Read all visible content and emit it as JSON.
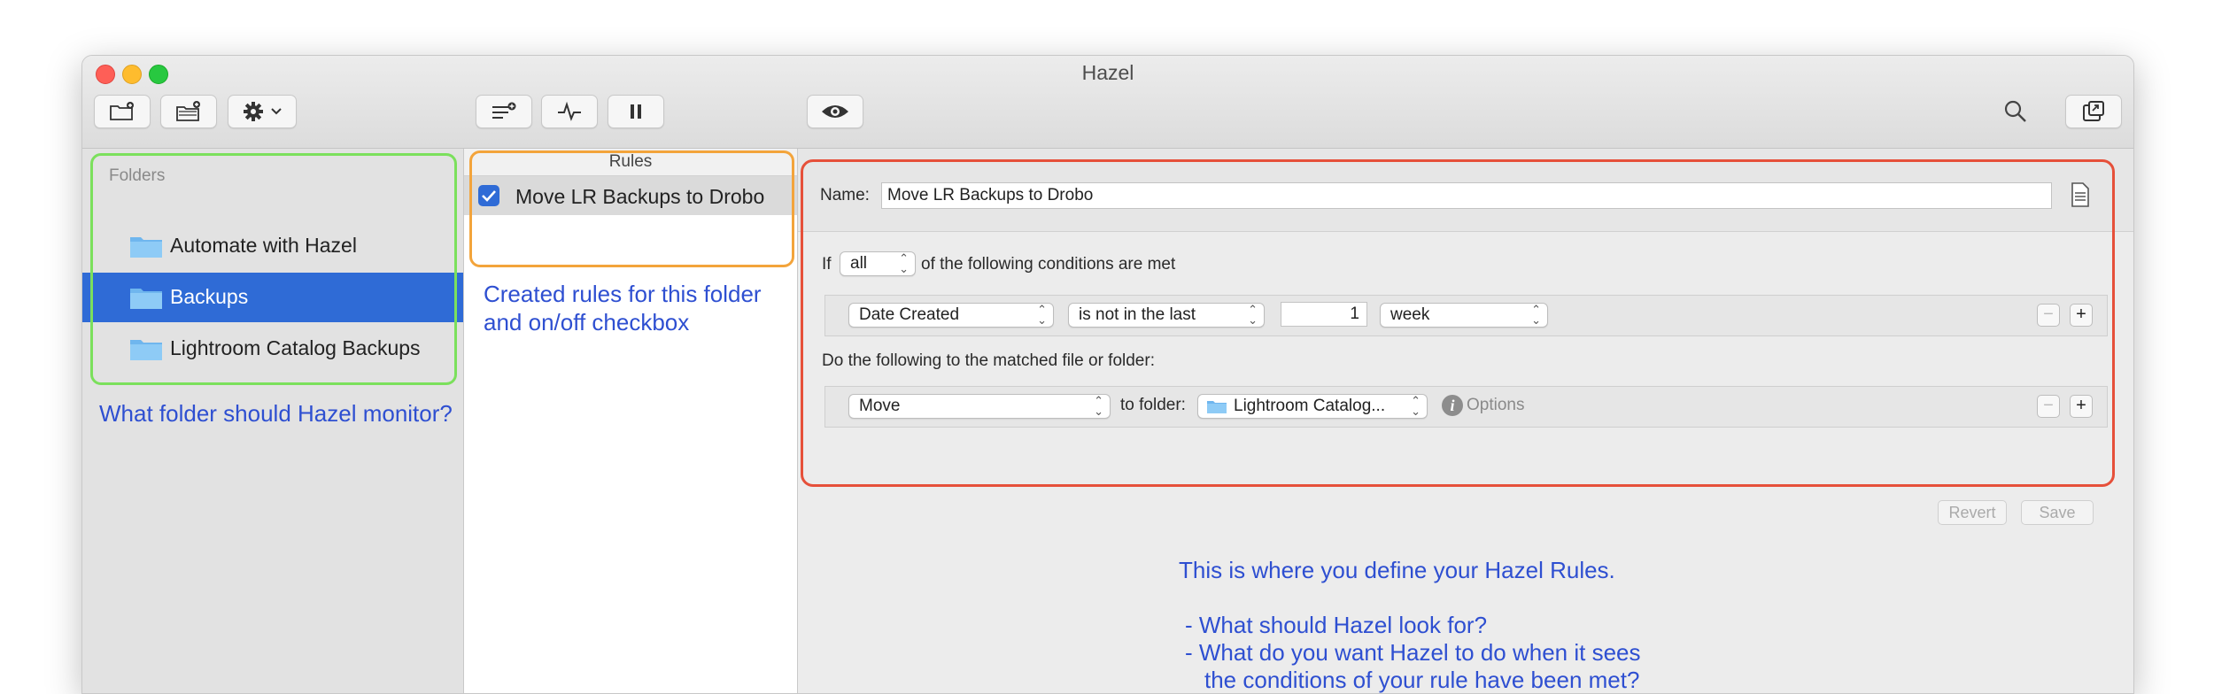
{
  "window": {
    "title": "Hazel"
  },
  "toolbar": {
    "icons": [
      "add-folder-icon",
      "add-folder-alt-icon",
      "gear-icon",
      "add-rule-icon",
      "activity-icon",
      "pause-icon",
      "eye-icon",
      "search-icon",
      "info-window-icon"
    ]
  },
  "folders": {
    "header": "Folders",
    "items": [
      {
        "label": "Automate with Hazel",
        "selected": false
      },
      {
        "label": "Backups",
        "selected": true
      },
      {
        "label": "Lightroom Catalog Backups",
        "selected": false
      }
    ]
  },
  "rules": {
    "header": "Rules",
    "items": [
      {
        "label": "Move LR Backups to Drobo",
        "enabled": true
      }
    ]
  },
  "editor": {
    "name_label": "Name:",
    "name_value": "Move LR Backups to Drobo",
    "if_label": "If",
    "match_value": "all",
    "conditions_suffix": "of the following conditions are met",
    "condition": {
      "attribute": "Date Created",
      "operator": "is not in the last",
      "amount": "1",
      "unit": "week"
    },
    "actions_label": "Do the following to the matched file or folder:",
    "action": {
      "verb": "Move",
      "to_folder_label": "to folder:",
      "folder": "Lightroom Catalog...",
      "options_label": "Options"
    },
    "revert_label": "Revert",
    "save_label": "Save"
  },
  "annotations": {
    "folders": "What folder should Hazel monitor?",
    "rules_line1": "Created rules for this folder",
    "rules_line2": "and on/off checkbox",
    "editor_line1": "This is where you define your Hazel Rules.",
    "editor_line2": "- What should Hazel look for?",
    "editor_line3": "- What do you want Hazel to do when it sees",
    "editor_line4": "the conditions of your rule have been met?"
  },
  "colors": {
    "selection": "#2f6bd6",
    "folders_box": "#7be05c",
    "rules_box": "#f3a43b",
    "editor_box": "#e6503a",
    "annotation_text": "#2e4fd1"
  }
}
